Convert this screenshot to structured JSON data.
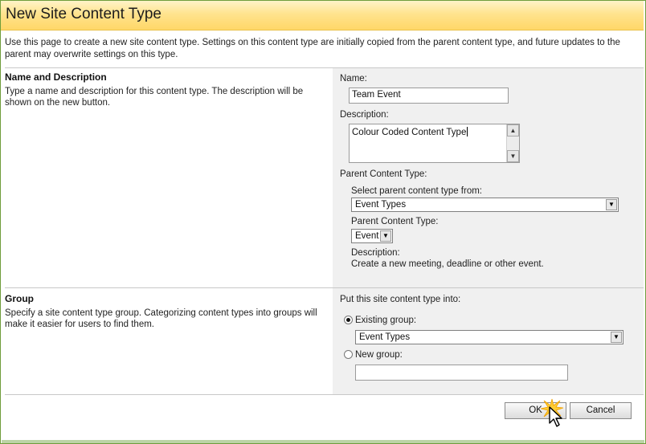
{
  "header": {
    "title": "New Site Content Type"
  },
  "intro": {
    "text": "Use this page to create a new site content type. Settings on this content type are initially copied from the parent content type, and future updates to the parent may overwrite settings on this type."
  },
  "name_section": {
    "title": "Name and Description",
    "description": "Type a name and description for this content type. The description will be shown on the new button.",
    "name_label": "Name:",
    "name_value": "Team Event",
    "description_label": "Description:",
    "description_value": "Colour Coded Content Type",
    "parent_label": "Parent Content Type:",
    "select_from_label": "Select parent content type from:",
    "select_from_value": "Event Types",
    "parent_type_label": "Parent Content Type:",
    "parent_type_value": "Event",
    "parent_desc_label": "Description:",
    "parent_desc_value": "Create a new meeting, deadline or other event."
  },
  "group_section": {
    "title": "Group",
    "description": "Specify a site content type group. Categorizing content types into groups will make it easier for users to find them.",
    "put_label": "Put this site content type into:",
    "existing_label": "Existing group:",
    "existing_value": "Event Types",
    "existing_selected": true,
    "new_label": "New group:",
    "new_value": ""
  },
  "buttons": {
    "ok": "OK",
    "cancel": "Cancel"
  },
  "colors": {
    "header_gradient_top": "#fff4c8",
    "header_gradient_bottom": "#ffd768",
    "panel_bg": "#f0f0f0",
    "frame_border": "#6f9d3c"
  },
  "icons": {
    "scroll_up": "▲",
    "scroll_down": "▼",
    "dropdown": "▼"
  }
}
